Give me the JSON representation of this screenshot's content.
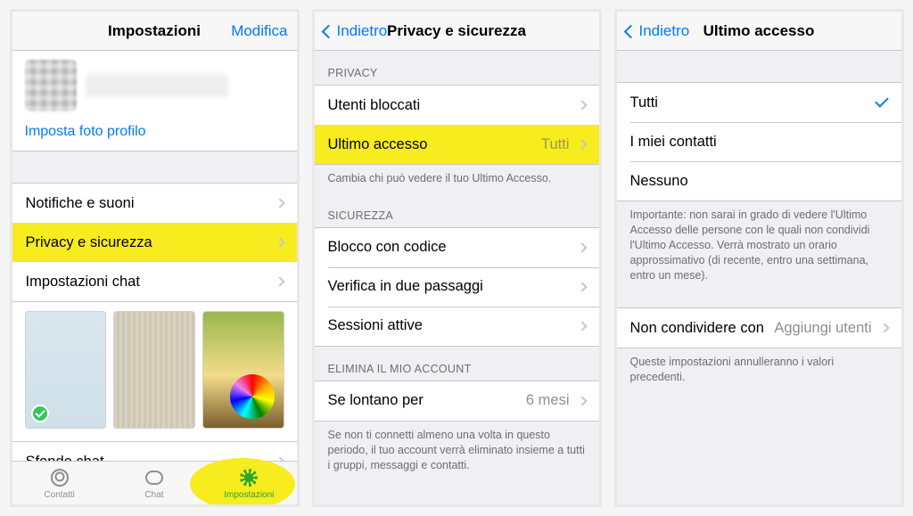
{
  "colors": {
    "accent": "#007aff",
    "highlight": "#f7ec1e",
    "green": "#34c759"
  },
  "screen1": {
    "title": "Impostazioni",
    "edit": "Modifica",
    "set_photo": "Imposta foto profilo",
    "rows": {
      "notifications": "Notifiche e suoni",
      "privacy": "Privacy e sicurezza",
      "chat_settings": "Impostazioni chat",
      "chat_bg": "Sfondo chat"
    },
    "tabs": {
      "contacts": "Contatti",
      "chat": "Chat",
      "settings": "Impostazioni"
    }
  },
  "screen2": {
    "back": "Indietro",
    "title": "Privacy e sicurezza",
    "privacy_header": "PRIVACY",
    "blocked": "Utenti bloccati",
    "last_seen": "Ultimo accesso",
    "last_seen_value": "Tutti",
    "last_seen_footer": "Cambia chi può vedere il tuo Ultimo Accesso.",
    "security_header": "SICUREZZA",
    "passcode": "Blocco con codice",
    "two_step": "Verifica in due passaggi",
    "sessions": "Sessioni attive",
    "delete_header": "ELIMINA IL MIO ACCOUNT",
    "away_label": "Se lontano per",
    "away_value": "6 mesi",
    "delete_footer": "Se non ti connetti almeno una volta in questo periodo, il tuo account verrà eliminato insieme a tutti i gruppi, messaggi e contatti."
  },
  "screen3": {
    "back": "Indietro",
    "title": "Ultimo accesso",
    "opt_everyone": "Tutti",
    "opt_contacts": "I miei contatti",
    "opt_nobody": "Nessuno",
    "note": "Importante: non sarai in grado di vedere l'Ultimo Accesso delle persone con le quali non condividi l'Ultimo Accesso. Verrà mostrato un orario approssimativo (di recente, entro una settimana, entro un mese).",
    "never_share": "Non condividere con",
    "add_users": "Aggiungi utenti",
    "override_note": "Queste impostazioni annulleranno i valori precedenti."
  }
}
